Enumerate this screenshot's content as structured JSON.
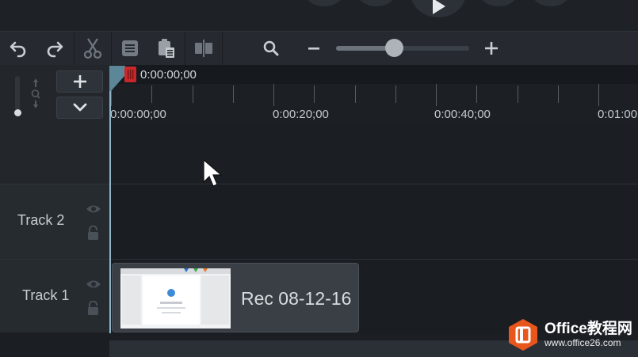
{
  "colors": {
    "accent_playhead": "#c8282a",
    "playhead_line": "#8fb4c6",
    "watermark_orange": "#e8561c"
  },
  "toolbar": {
    "buttons": [
      "undo-icon",
      "redo-icon",
      "cut-icon",
      "copy-icon",
      "paste-icon",
      "split-icon"
    ],
    "zoom_out_icon": "zoom-magnifier-icon",
    "zoom_level": 0.44
  },
  "timeline": {
    "playhead_time": "0:00:00;00",
    "ruler_ticks": [
      "0:00:00;00",
      "0:00:20;00",
      "0:00:40;00",
      "0:01:00"
    ]
  },
  "track_header": {
    "add_track_icon": "plus-icon",
    "collapse_icon": "chevron-down-icon"
  },
  "tracks": [
    {
      "name": "Track 2"
    },
    {
      "name": "Track 1",
      "clip": {
        "label": "Rec 08-12-16"
      }
    }
  ],
  "watermark": {
    "title": "Office教程网",
    "url": "www.office26.com"
  }
}
